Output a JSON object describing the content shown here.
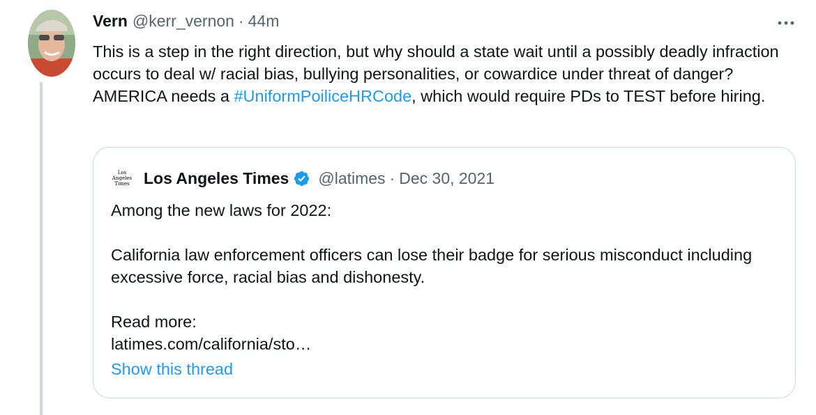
{
  "tweet": {
    "author_name": "Vern",
    "author_handle": "@kerr_vernon",
    "separator": "·",
    "time": "44m",
    "avatar_icon": "user-avatar-photo-icon",
    "more_icon": "more-options-icon",
    "text_part1": "This is a step in the right direction, but why should a state wait until a possibly deadly infraction occurs to deal w/ racial bias, bullying personalities, or cowardice under threat of danger?  AMERICA needs a ",
    "hashtag": "#UniformPoiliceHRCode",
    "text_part2": ", which would require PDs to TEST before hiring."
  },
  "quote": {
    "logo_line1": "Los",
    "logo_line2": "Angeles",
    "logo_line3": "Times",
    "author_name": "Los Angeles Times",
    "verified_icon": "verified-badge-icon",
    "author_handle": "@latimes",
    "separator": "·",
    "date": "Dec 30, 2021",
    "line1": "Among the new laws for 2022:",
    "line2": "California law enforcement officers can lose their badge for serious misconduct including excessive force, racial bias and dishonesty.",
    "line3": "Read more:",
    "line4": "latimes.com/california/sto…",
    "show_thread": "Show this thread"
  },
  "colors": {
    "link": "#1d9bf0",
    "secondary_text": "#536471",
    "border": "#cfd9de",
    "primary_text": "#0f1419"
  }
}
